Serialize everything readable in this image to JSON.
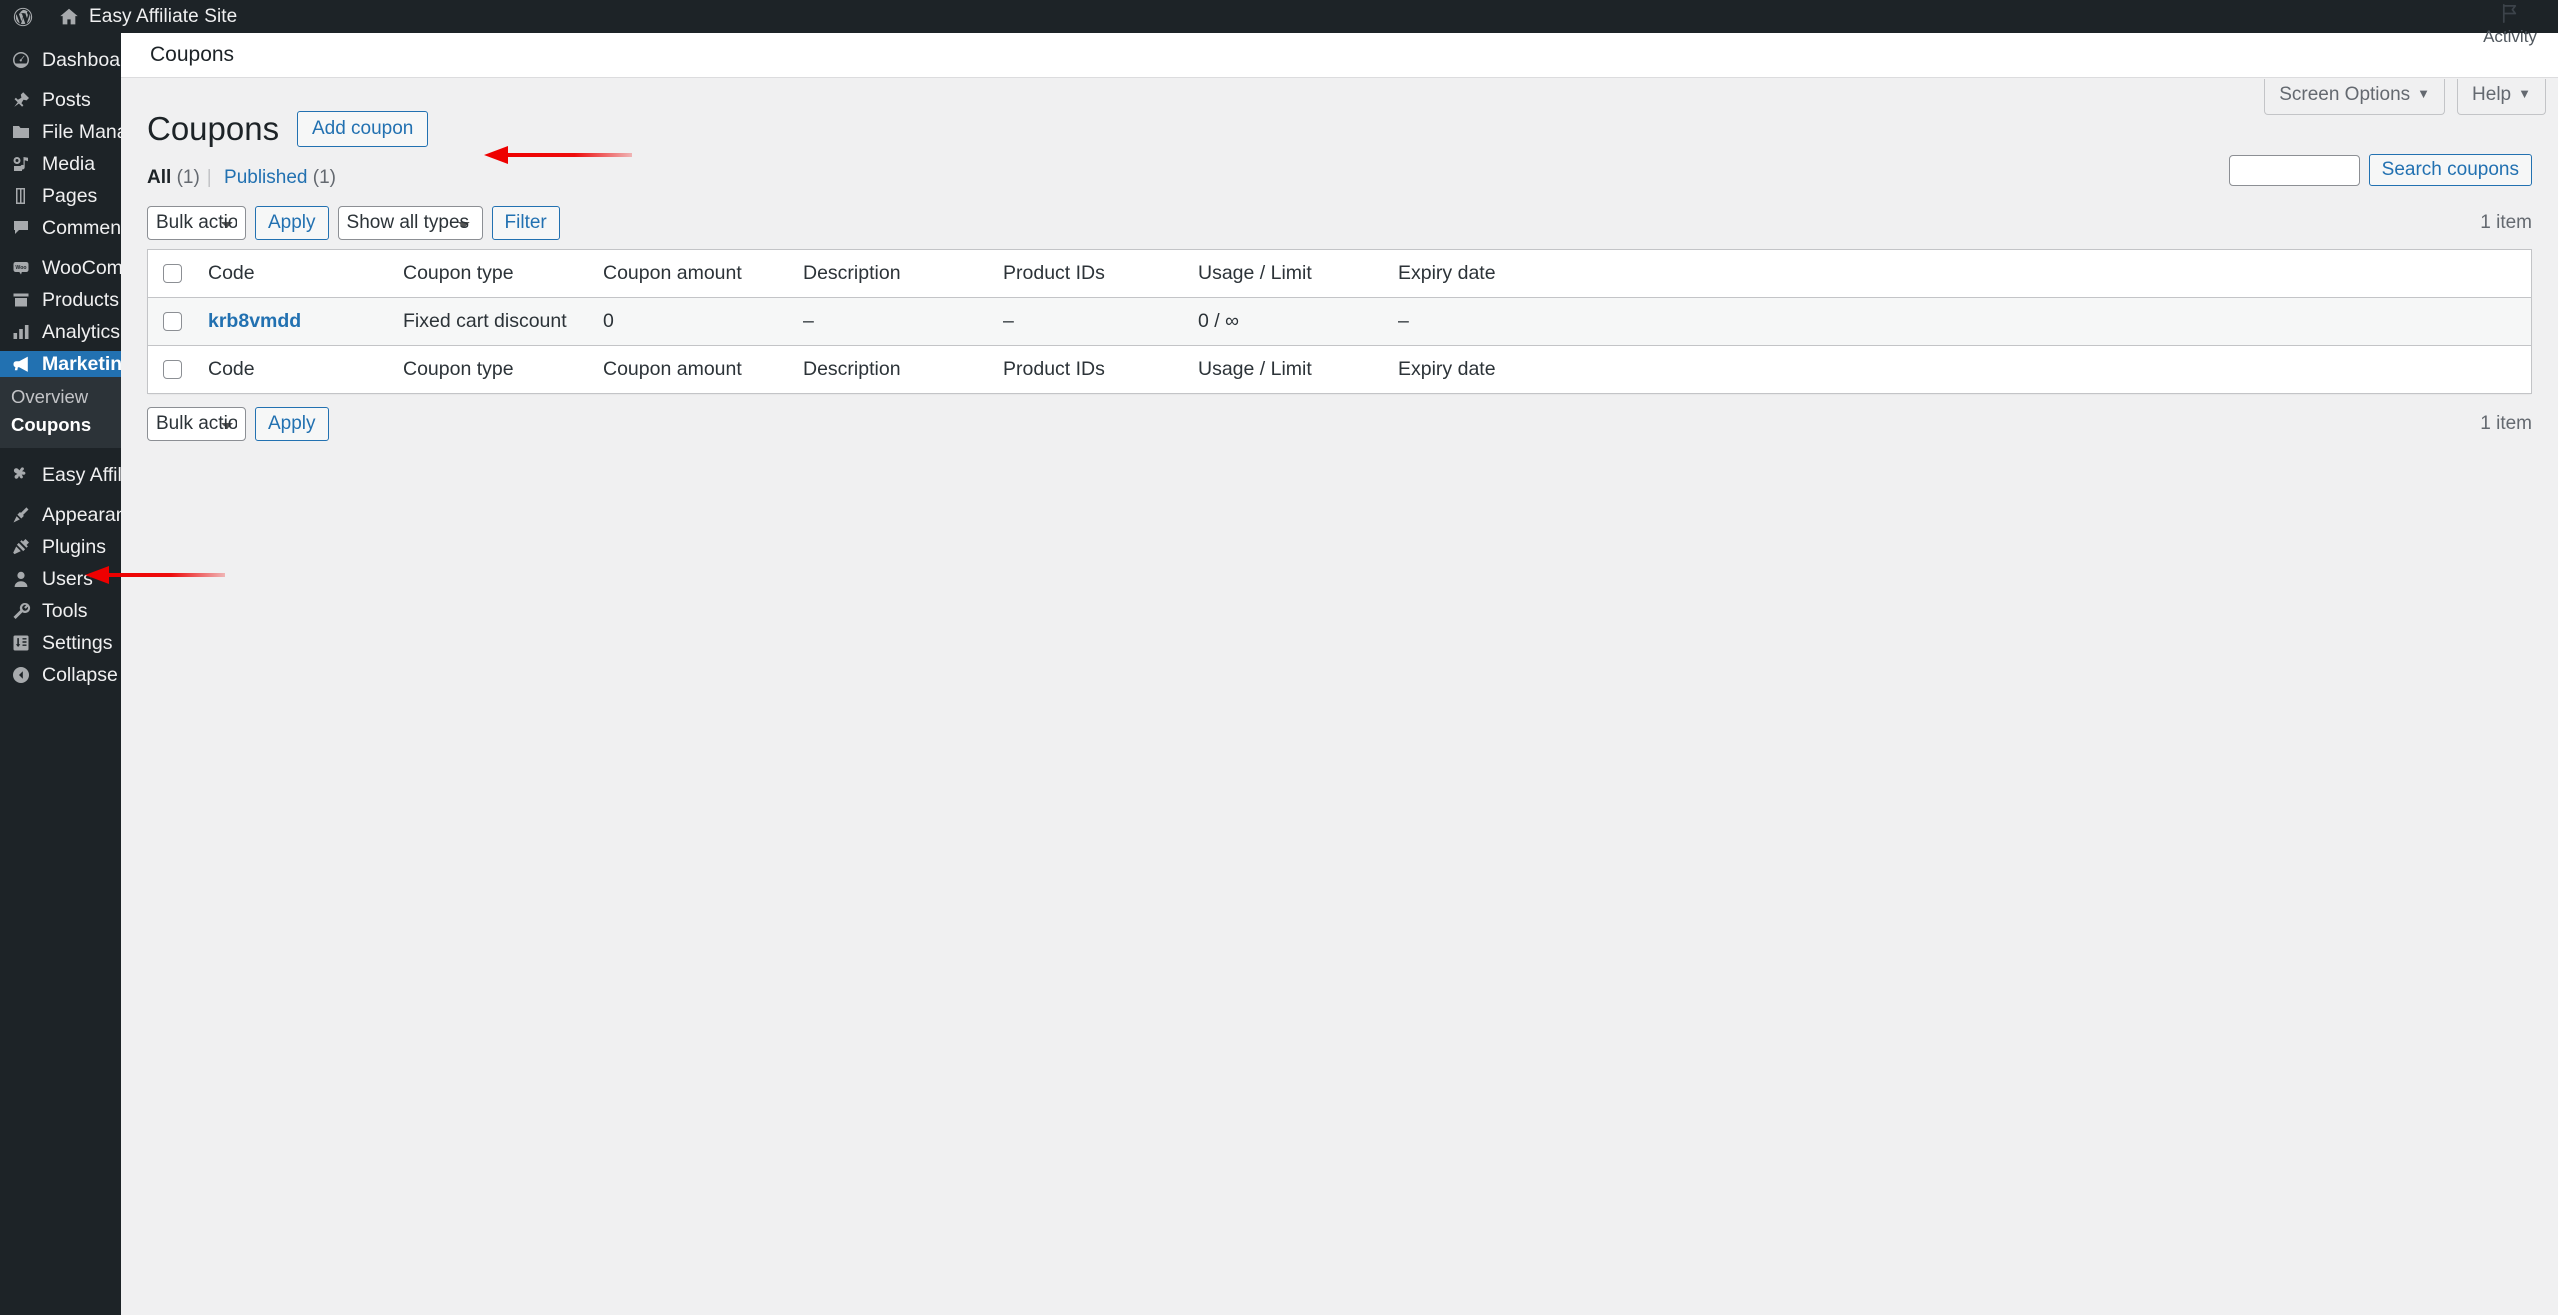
{
  "adminbar": {
    "wp_logo_icon": "wordpress-logo-icon",
    "site_home_icon": "home-icon",
    "site_name": "Easy Affiliate Site"
  },
  "sidebar": {
    "items": [
      {
        "label": "Dashboard",
        "icon": "dashboard-icon",
        "current": false,
        "gap_before": true
      },
      {
        "label": "Posts",
        "icon": "posts-pin-icon",
        "current": false,
        "gap_before": true
      },
      {
        "label": "File Manager",
        "icon": "folder-icon",
        "current": false,
        "gap_before": false
      },
      {
        "label": "Media",
        "icon": "media-icon",
        "current": false,
        "gap_before": false
      },
      {
        "label": "Pages",
        "icon": "pages-icon",
        "current": false,
        "gap_before": false
      },
      {
        "label": "Comments",
        "icon": "comments-icon",
        "current": false,
        "gap_before": false
      },
      {
        "label": "WooCommerce",
        "icon": "woocommerce-icon",
        "current": false,
        "gap_before": true
      },
      {
        "label": "Products",
        "icon": "products-icon",
        "current": false,
        "gap_before": false
      },
      {
        "label": "Analytics",
        "icon": "analytics-bar-icon",
        "current": false,
        "gap_before": false
      },
      {
        "label": "Marketing",
        "icon": "megaphone-icon",
        "current": true,
        "gap_before": false
      }
    ],
    "submenu": [
      {
        "label": "Overview",
        "current": false
      },
      {
        "label": "Coupons",
        "current": true
      }
    ],
    "items_after": [
      {
        "label": "Easy Affiliate",
        "icon": "easy-affiliate-icon",
        "gap_before": true
      },
      {
        "label": "Appearance",
        "icon": "appearance-brush-icon",
        "gap_before": true
      },
      {
        "label": "Plugins",
        "icon": "plugins-plug-icon",
        "gap_before": false
      },
      {
        "label": "Users",
        "icon": "users-icon",
        "gap_before": false
      },
      {
        "label": "Tools",
        "icon": "tools-wrench-icon",
        "gap_before": false
      },
      {
        "label": "Settings",
        "icon": "settings-sliders-icon",
        "gap_before": false
      },
      {
        "label": "Collapse menu",
        "icon": "collapse-arrow-icon",
        "gap_before": false
      }
    ]
  },
  "content_header": {
    "breadcrumb": "Coupons",
    "activity_label": "Activity",
    "activity_icon": "flag-icon"
  },
  "screen_meta": {
    "screen_options": "Screen Options",
    "help": "Help",
    "caret_icon": "chevron-down-icon"
  },
  "page": {
    "title": "Coupons",
    "add_button": "Add coupon",
    "views": [
      {
        "label": "All",
        "count": "(1)",
        "current": true
      },
      {
        "label": "Published",
        "count": "(1)",
        "current": false
      }
    ],
    "view_separator": "|"
  },
  "search": {
    "value": "",
    "placeholder": "",
    "button_label": "Search coupons"
  },
  "tablenav_top": {
    "bulk_actions_selected": "Bulk actions",
    "apply_label": "Apply",
    "type_filter_selected": "Show all types",
    "filter_label": "Filter",
    "displaying_num": "1 item"
  },
  "tablenav_bottom": {
    "bulk_actions_selected": "Bulk actions",
    "apply_label": "Apply",
    "displaying_num": "1 item"
  },
  "table": {
    "columns": [
      "Code",
      "Coupon type",
      "Coupon amount",
      "Description",
      "Product IDs",
      "Usage / Limit",
      "Expiry date"
    ],
    "rows": [
      {
        "code": "krb8vmdd",
        "coupon_type": "Fixed cart discount",
        "coupon_amount": "0",
        "description": "–",
        "product_ids": "–",
        "usage_limit": "0 / ∞",
        "expiry_date": "–"
      }
    ]
  },
  "annotations": {
    "arrow_color": "#ee0000",
    "arrows": [
      {
        "name": "arrow-to-add-coupon"
      },
      {
        "name": "arrow-to-coupons-submenu"
      }
    ]
  },
  "colors": {
    "admin_bar_bg": "#1d2327",
    "sidebar_bg": "#1d2327",
    "submenu_bg": "#2c3338",
    "accent_blue": "#2271b1",
    "content_bg": "#f0f0f1"
  }
}
